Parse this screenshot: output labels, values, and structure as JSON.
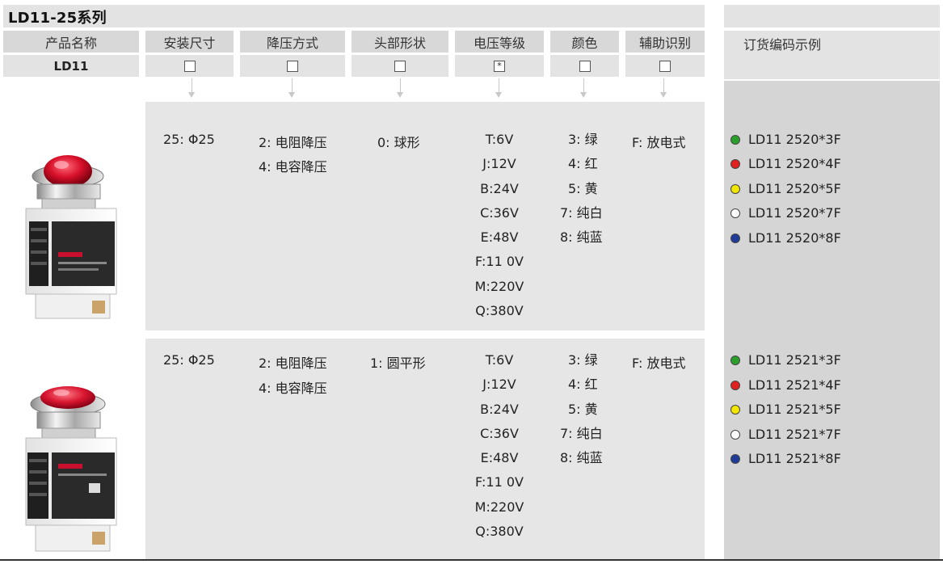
{
  "series_title": "LD11-25系列",
  "headers": {
    "product_name": "产品名称",
    "mount_size": "安装尺寸",
    "step_down": "降压方式",
    "head_shape": "头部形状",
    "voltage": "电压等级",
    "color": "颜色",
    "aux_id": "辅助识别",
    "order_example": "订货编码示例"
  },
  "product_code": "LD11",
  "voltage_mark": "*",
  "rows": [
    {
      "mount_size": "25: Φ25",
      "step_down": [
        "2: 电阻降压",
        "4: 电容降压"
      ],
      "head_shape": "0: 球形",
      "voltages": [
        "T:6V",
        "J:12V",
        "B:24V",
        "C:36V",
        "E:48V",
        "F:11 0V",
        "M:220V",
        "Q:380V"
      ],
      "colors": [
        "3: 绿",
        "4: 红",
        "5: 黄",
        "7: 纯白",
        "8: 纯蓝"
      ],
      "aux": "F: 放电式",
      "order_codes": [
        {
          "code": "LD11 2520*3F",
          "dot": "#2aa02a"
        },
        {
          "code": "LD11 2520*4F",
          "dot": "#e01f1f"
        },
        {
          "code": "LD11 2520*5F",
          "dot": "#f2e600"
        },
        {
          "code": "LD11 2520*7F",
          "dot": "#ffffff"
        },
        {
          "code": "LD11 2520*8F",
          "dot": "#1f3c99"
        }
      ]
    },
    {
      "mount_size": "25: Φ25",
      "step_down": [
        "2: 电阻降压",
        "4: 电容降压"
      ],
      "head_shape": "1: 圆平形",
      "voltages": [
        "T:6V",
        "J:12V",
        "B:24V",
        "C:36V",
        "E:48V",
        "F:11 0V",
        "M:220V",
        "Q:380V"
      ],
      "colors": [
        "3: 绿",
        "4: 红",
        "5: 黄",
        "7: 纯白",
        "8: 纯蓝"
      ],
      "aux": "F: 放电式",
      "order_codes": [
        {
          "code": "LD11 2521*3F",
          "dot": "#2aa02a"
        },
        {
          "code": "LD11 2521*4F",
          "dot": "#e01f1f"
        },
        {
          "code": "LD11 2521*5F",
          "dot": "#f2e600"
        },
        {
          "code": "LD11 2521*7F",
          "dot": "#ffffff"
        },
        {
          "code": "LD11 2521*8F",
          "dot": "#1f3c99"
        }
      ]
    }
  ]
}
